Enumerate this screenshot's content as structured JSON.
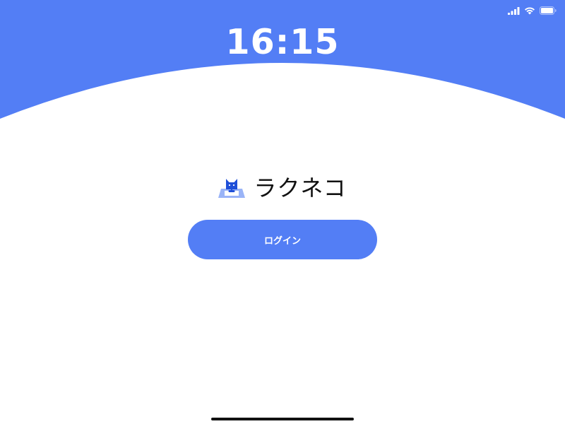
{
  "status_bar": {
    "icons": [
      "cellular-signal-icon",
      "wifi-icon",
      "battery-icon"
    ]
  },
  "clock": {
    "time": "16:15"
  },
  "brand": {
    "logo_icon": "cat-laptop-logo-icon",
    "name": "ラクネコ"
  },
  "login": {
    "label": "ログイン"
  },
  "colors": {
    "accent": "#537ef5",
    "background": "#ffffff",
    "text": "#111111",
    "home_indicator": "#111111",
    "status_icons": "#ffffff"
  }
}
